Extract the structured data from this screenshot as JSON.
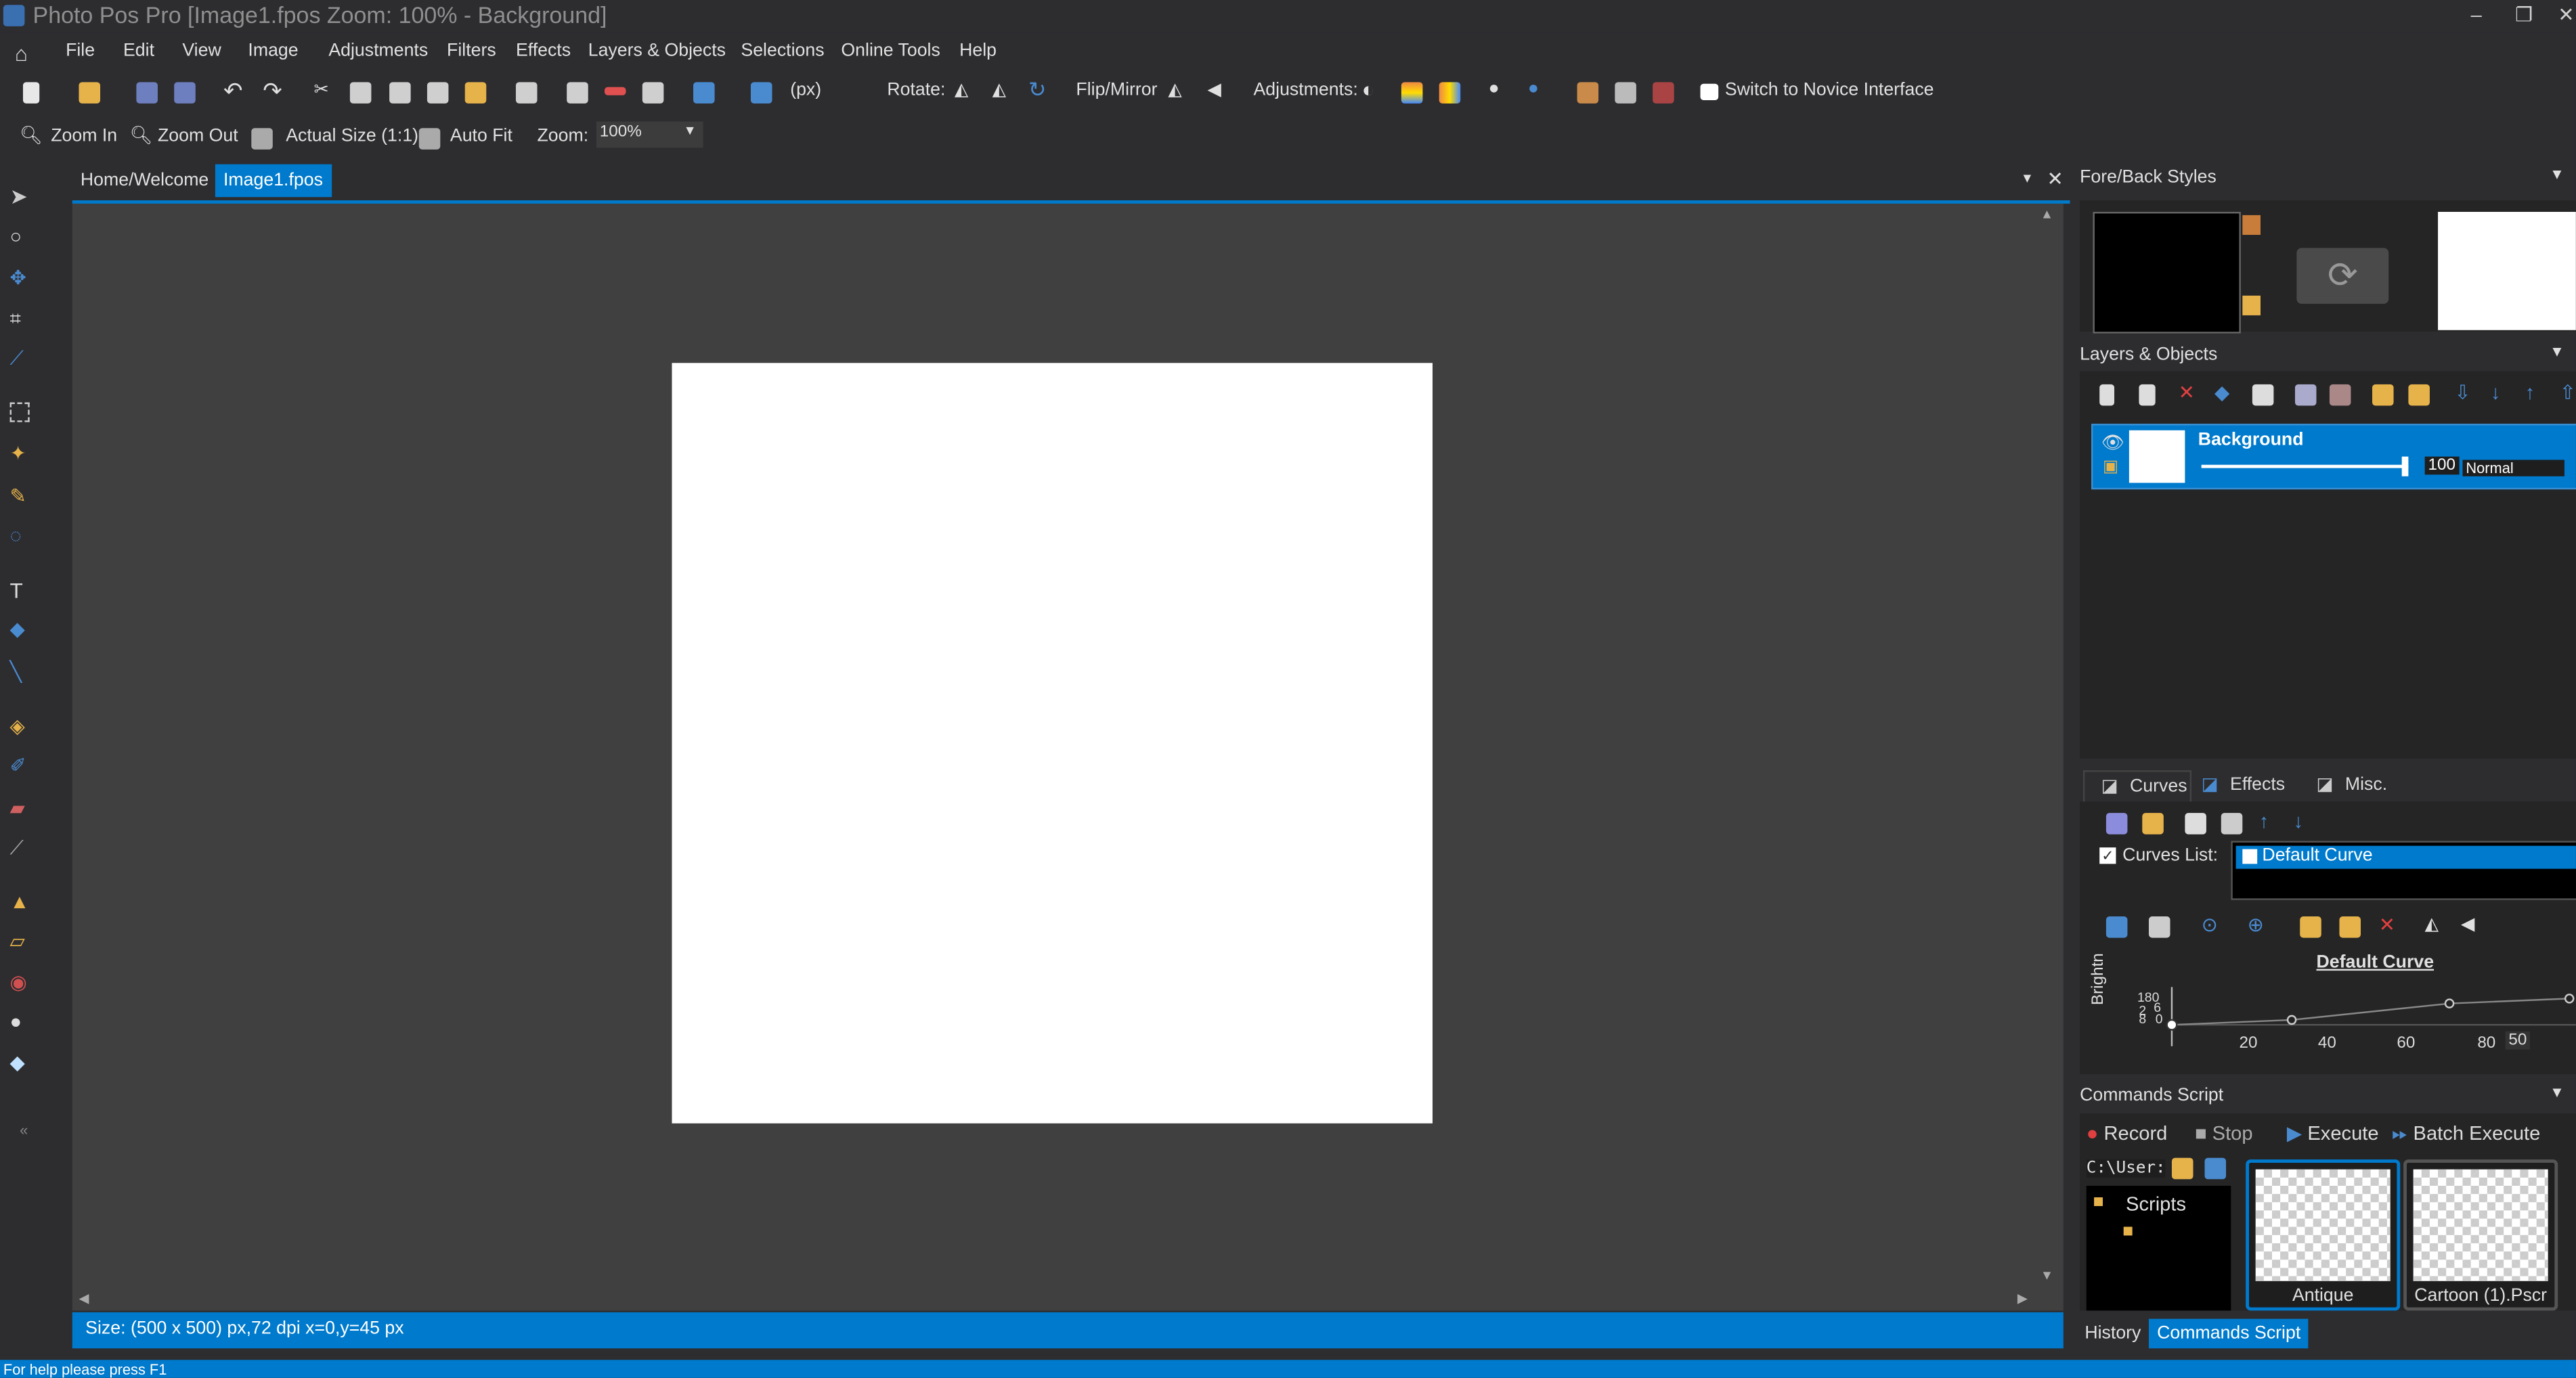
{
  "window": {
    "title": "Photo Pos Pro [Image1.fpos Zoom: 100% - Background]",
    "minimize": "–",
    "restore": "❐",
    "close": "✕"
  },
  "menu": [
    "File",
    "Edit",
    "View",
    "Image",
    "Adjustments",
    "Filters",
    "Effects",
    "Layers & Objects",
    "Selections",
    "Online Tools",
    "Help"
  ],
  "toolbar1": {
    "units": "(px)",
    "rotate_label": "Rotate:",
    "flip_label": "Flip/Mirror",
    "adjustments_label": "Adjustments:",
    "novice_button": "Switch to Novice Interface"
  },
  "toolbar2": {
    "zoom_in": "Zoom In",
    "zoom_out": "Zoom Out",
    "actual_size": "Actual Size (1:1)",
    "auto_fit": "Auto Fit",
    "zoom_label": "Zoom:",
    "zoom_value": "100%"
  },
  "doc_tabs": [
    {
      "label": "Home/Welcome",
      "active": false
    },
    {
      "label": "Image1.fpos",
      "active": true
    }
  ],
  "status": {
    "document": "Size: (500 x 500) px,72 dpi   x=0,y=45 px",
    "help": "For help please press F1"
  },
  "panels": {
    "fore_back": {
      "title": "Fore/Back Styles",
      "fore_color": "#000000",
      "back_color": "#ffffff"
    },
    "layers": {
      "title": "Layers & Objects",
      "layer_name": "Background",
      "opacity": "100",
      "blend_mode": "Normal"
    },
    "curves": {
      "tabs": [
        "Curves",
        "Effects",
        "Misc."
      ],
      "curves_list_label": "Curves List:",
      "selected_curve": "Default Curve",
      "curve_title": "Default Curve",
      "y_axis_label": "Brightn",
      "y_ticks": [
        "180",
        "6",
        "2",
        "8",
        "0"
      ],
      "x_ticks": [
        "20",
        "40",
        "60",
        "80",
        "50"
      ]
    },
    "commands": {
      "title": "Commands Script",
      "record": "Record",
      "stop": "Stop",
      "execute": "Execute",
      "batch_execute": "Batch Execute",
      "path": "C:\\User:",
      "folder": "Scripts",
      "thumbs": [
        "Antique",
        "Cartoon (1).Pscr"
      ]
    },
    "bottom_tabs": [
      "History",
      "Commands Script"
    ]
  },
  "colors": {
    "accent": "#007acc",
    "bg": "#2d2d30",
    "canvas_bg": "#404040"
  }
}
